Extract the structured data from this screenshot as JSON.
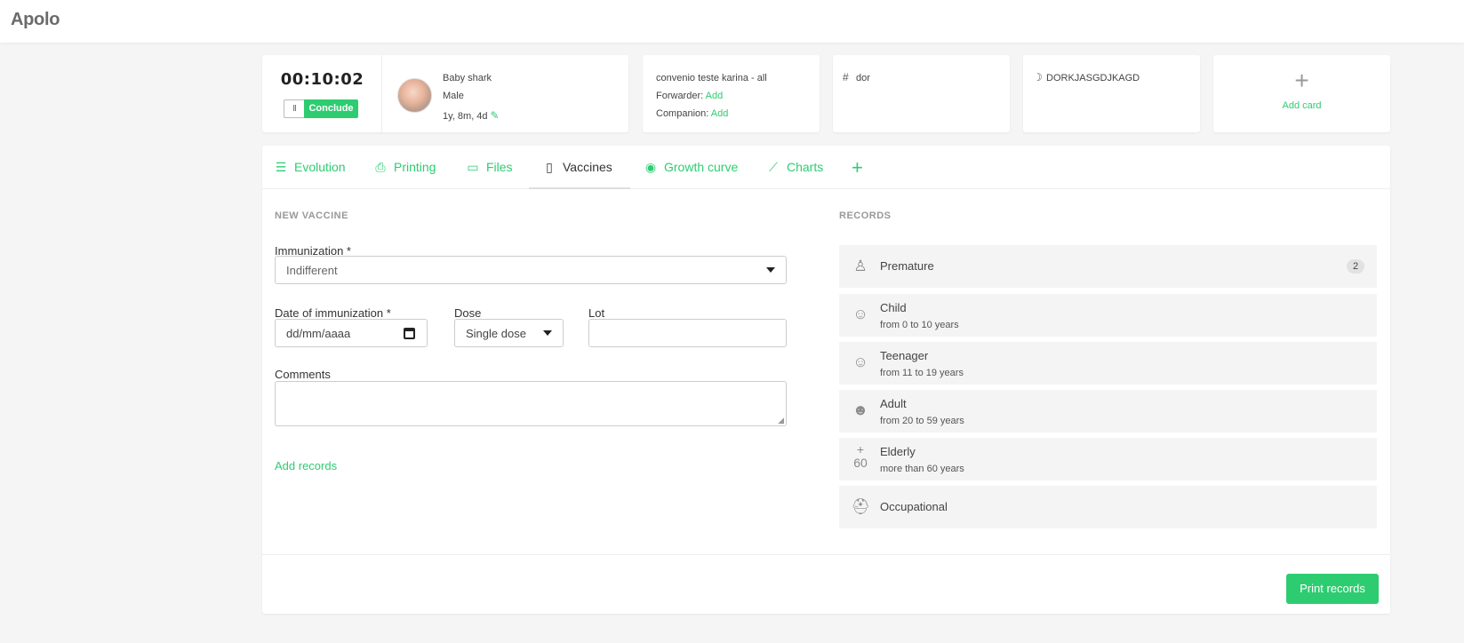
{
  "app": {
    "logo": "Apolo"
  },
  "patient_card": {
    "timer": "00:10:02",
    "pause_label": "II",
    "conclude_label": "Conclude",
    "name": "Baby shark",
    "sex": "Male",
    "age": "1y, 8m, 4d"
  },
  "insurance_card": {
    "plan": "convenio teste karina - all",
    "forwarder_label": "Forwarder:",
    "forwarder_action": "Add",
    "companion_label": "Companion:",
    "companion_action": "Add"
  },
  "tag_card": {
    "icon": "#",
    "text": "dor"
  },
  "code_card": {
    "icon": "☽",
    "text": "DORKJASGDJKAGD"
  },
  "add_card": {
    "icon": "+",
    "label": "Add card"
  },
  "tabs": [
    {
      "label": "Evolution",
      "icon": "list-icon"
    },
    {
      "label": "Printing",
      "icon": "printer-icon"
    },
    {
      "label": "Files",
      "icon": "folder-icon"
    },
    {
      "label": "Vaccines",
      "icon": "vaccine-icon",
      "active": true
    },
    {
      "label": "Growth curve",
      "icon": "eye-icon"
    },
    {
      "label": "Charts",
      "icon": "line-chart-icon"
    }
  ],
  "tab_add": "+",
  "new_vaccine": {
    "section_label": "NEW VACCINE",
    "immunization_label": "Immunization *",
    "immunization_value": "Indifferent",
    "date_label": "Date of immunization *",
    "date_placeholder": "dd/mm/aaaa",
    "dose_label": "Dose",
    "dose_value": "Single dose",
    "lot_label": "Lot",
    "lot_value": "",
    "comments_label": "Comments",
    "comments_value": "",
    "add_records": "Add records"
  },
  "records": {
    "section_label": "RECORDS",
    "items": [
      {
        "title": "Premature",
        "subtitle": "",
        "badge": "2",
        "icon": "baby-icon"
      },
      {
        "title": "Child",
        "subtitle": "from 0 to 10 years",
        "icon": "child-face-icon"
      },
      {
        "title": "Teenager",
        "subtitle": "from 11 to 19 years",
        "icon": "teen-face-icon"
      },
      {
        "title": "Adult",
        "subtitle": "from 20 to 59 years",
        "icon": "adult-face-icon"
      },
      {
        "title": "Elderly",
        "subtitle": "more than 60 years",
        "icon": "plus-60-icon"
      },
      {
        "title": "Occupational",
        "subtitle": "",
        "icon": "hard-hat-icon"
      }
    ]
  },
  "print_records": "Print records",
  "colors": {
    "accent": "#2ecc71",
    "background": "#f5f5f5",
    "record_bg": "#f4f4f4"
  }
}
